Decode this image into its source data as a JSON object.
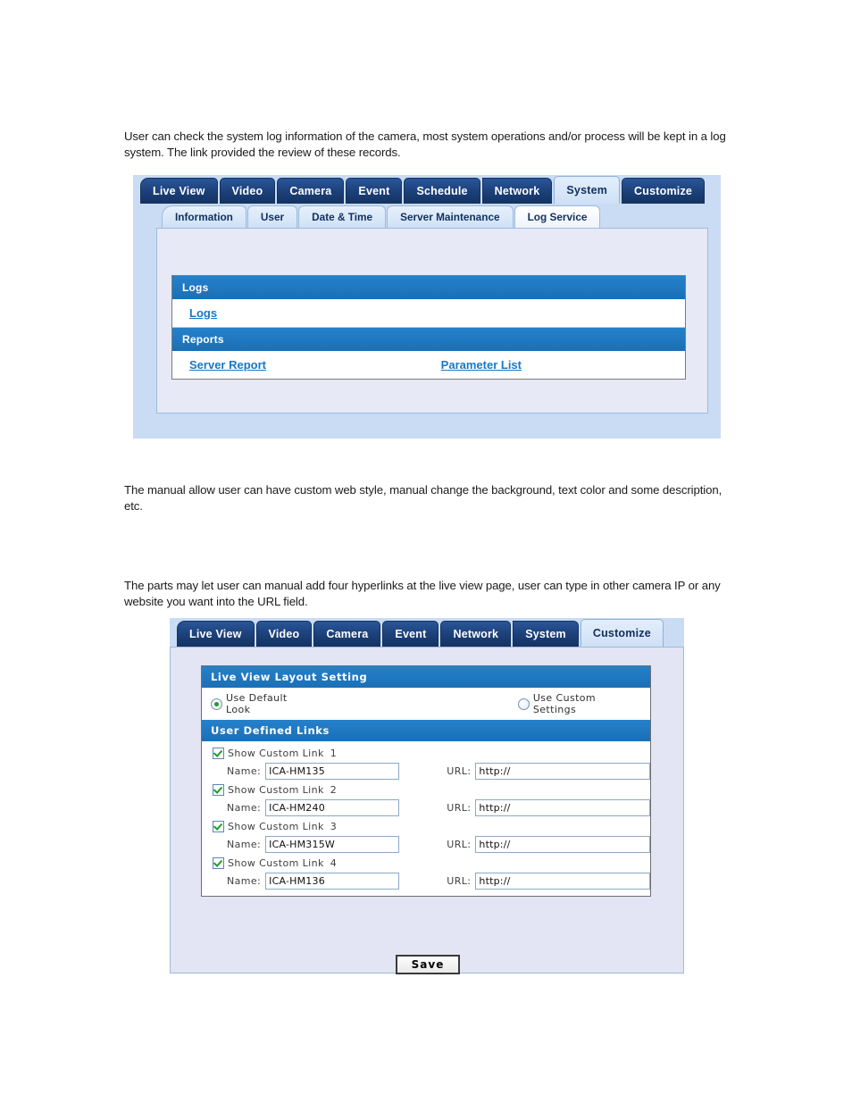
{
  "paragraphs": {
    "p1": "User can check the system log information of the camera, most system operations and/or process will be kept in a log system. The link provided the review of these records.",
    "p2": "The manual allow user can have custom web style, manual change the background, text color and some description, etc.",
    "p3": "The parts may let user can manual add four hyperlinks at the live view page, user can type in other camera IP or any website you want into the URL field."
  },
  "log_panel": {
    "tabs": [
      {
        "label": "Live View",
        "active": false
      },
      {
        "label": "Video",
        "active": false
      },
      {
        "label": "Camera",
        "active": false
      },
      {
        "label": "Event",
        "active": false
      },
      {
        "label": "Schedule",
        "active": false
      },
      {
        "label": "Network",
        "active": false
      },
      {
        "label": "System",
        "active": true
      },
      {
        "label": "Customize",
        "active": false
      }
    ],
    "subtabs": [
      {
        "label": "Information",
        "active": false
      },
      {
        "label": "User",
        "active": false
      },
      {
        "label": "Date & Time",
        "active": false
      },
      {
        "label": "Server Maintenance",
        "active": false
      },
      {
        "label": "Log Service",
        "active": true
      }
    ],
    "sections": {
      "logs_header": "Logs",
      "logs_link": "Logs",
      "reports_header": "Reports",
      "server_report_link": "Server Report",
      "parameter_list_link": "Parameter List"
    }
  },
  "customize_panel": {
    "tabs": [
      {
        "label": "Live View",
        "active": false
      },
      {
        "label": "Video",
        "active": false
      },
      {
        "label": "Camera",
        "active": false
      },
      {
        "label": "Event",
        "active": false
      },
      {
        "label": "Network",
        "active": false
      },
      {
        "label": "System",
        "active": false
      },
      {
        "label": "Customize",
        "active": true
      }
    ],
    "layout_header": "Live View Layout Setting",
    "radio_default": "Use Default Look",
    "radio_custom": "Use Custom Settings",
    "links_header": "User Defined Links",
    "name_label": "Name:",
    "url_label": "URL:",
    "links": [
      {
        "show_label": "Show Custom Link",
        "number": "1",
        "checked": true,
        "name": "ICA-HM135",
        "url": "http://"
      },
      {
        "show_label": "Show Custom Link",
        "number": "2",
        "checked": true,
        "name": "ICA-HM240",
        "url": "http://"
      },
      {
        "show_label": "Show Custom Link",
        "number": "3",
        "checked": true,
        "name": "ICA-HM315W",
        "url": "http://"
      },
      {
        "show_label": "Show Custom Link",
        "number": "4",
        "checked": true,
        "name": "ICA-HM136",
        "url": "http://"
      }
    ],
    "save_label": "Save"
  },
  "colors": {
    "tab_navy": "#1b3f77",
    "tab_active": "#cfe0f6",
    "section_blue": "#1b74bd",
    "link_blue": "#1878c8",
    "panel_bg": "#c9dcf4",
    "body_bg": "#e7e9f7",
    "check_green": "#18a02a"
  }
}
